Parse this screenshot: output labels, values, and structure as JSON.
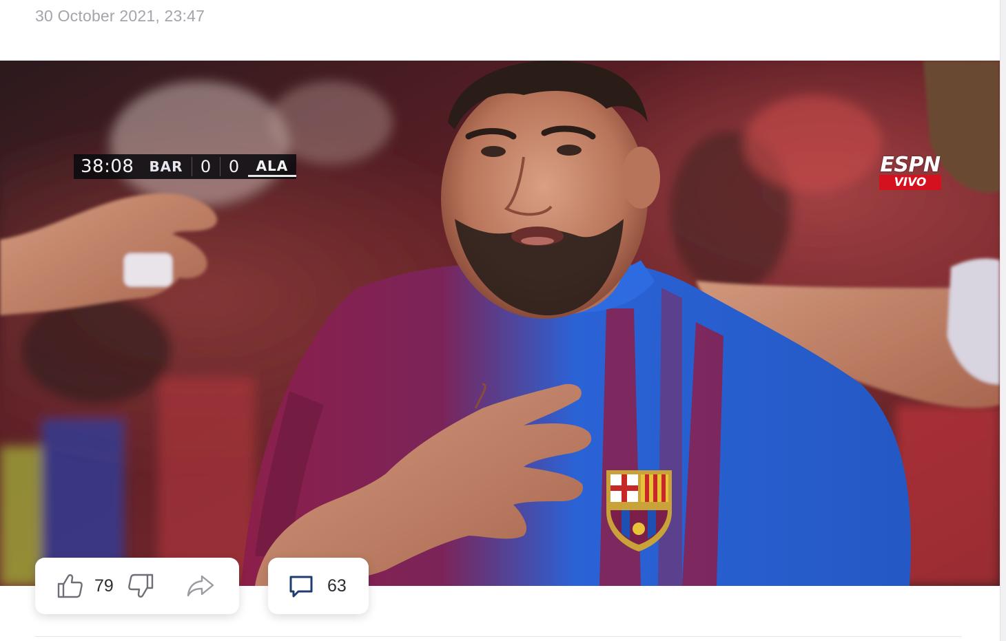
{
  "post": {
    "timestamp": "30 October 2021, 23:47"
  },
  "media": {
    "scorebug": {
      "clock": "38:08",
      "home_team": "BAR",
      "home_score": "0",
      "away_score": "0",
      "away_team": "ALA"
    },
    "broadcaster": {
      "name": "ESPN",
      "badge": "VIVO",
      "badge_color": "#d4111e"
    }
  },
  "actions": {
    "likes": {
      "icon": "thumbs-up-icon",
      "count": "79"
    },
    "dislike": {
      "icon": "thumbs-down-icon"
    },
    "share": {
      "icon": "share-arrow-icon"
    },
    "comments": {
      "icon": "comment-bubble-icon",
      "count": "63"
    }
  },
  "colors": {
    "background": "#ffffff",
    "timestamp": "#a4a4aa",
    "icon": "#6e6e78",
    "comment_icon": "#1f3b6f",
    "kit_blue": "#2a63d6",
    "kit_garnet": "#8c1f4a"
  }
}
